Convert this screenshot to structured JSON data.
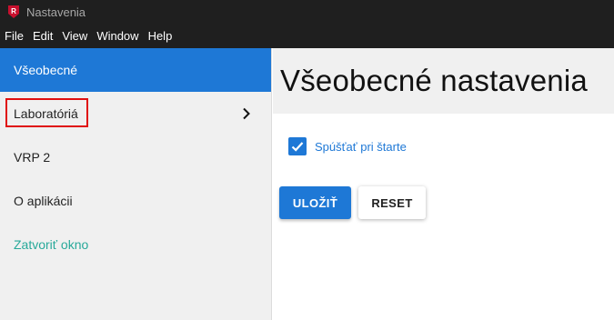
{
  "window": {
    "title": "Nastavenia",
    "app_icon": "app-logo-icon",
    "app_icon_letter": "R"
  },
  "menubar": {
    "items": [
      "File",
      "Edit",
      "View",
      "Window",
      "Help"
    ]
  },
  "sidebar": {
    "items": [
      {
        "label": "Všeobecné",
        "state": "active"
      },
      {
        "label": "Laboratóriá",
        "icon": "chevron-right-icon",
        "highlighted": true
      },
      {
        "label": "VRP 2"
      },
      {
        "label": "O aplikácii"
      },
      {
        "label": "Zatvoriť okno",
        "color": "#28a99a"
      }
    ]
  },
  "main": {
    "title": "Všeobecné nastavenia",
    "checkbox": {
      "label": "Spúšťať pri štarte",
      "checked": true,
      "icon": "checkmark-icon"
    },
    "buttons": {
      "save_label": "ULOŽIŤ",
      "reset_label": "RESET"
    }
  },
  "colors": {
    "accent": "#1e78d6",
    "highlight_border": "#e01010",
    "titlebar": "#1f1f1f",
    "sidebar_bg": "#f0f0f0"
  }
}
